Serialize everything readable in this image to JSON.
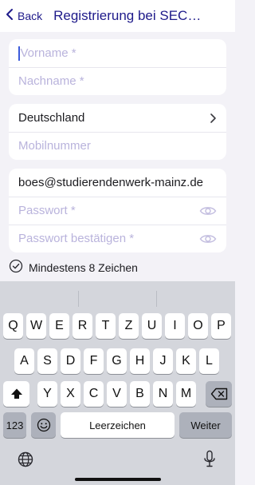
{
  "header": {
    "back_label": "Back",
    "title": "Registrierung bei SEC…"
  },
  "form": {
    "vorname_placeholder": "Vorname *",
    "nachname_placeholder": "Nachname *",
    "country_value": "Deutschland",
    "mobile_placeholder": "Mobilnummer",
    "email_value": "boes@studierendenwerk-mainz.de",
    "password_placeholder": "Passwort *",
    "password_confirm_placeholder": "Passwort bestätigen *"
  },
  "hint": {
    "text": "Mindestens 8 Zeichen"
  },
  "keyboard": {
    "row1": [
      "Q",
      "W",
      "E",
      "R",
      "T",
      "Z",
      "U",
      "I",
      "O",
      "P"
    ],
    "row2": [
      "A",
      "S",
      "D",
      "F",
      "G",
      "H",
      "J",
      "K",
      "L"
    ],
    "row3": [
      "Y",
      "X",
      "C",
      "V",
      "B",
      "N",
      "M"
    ],
    "numbers_label": "123",
    "space_label": "Leerzeichen",
    "return_label": "Weiter"
  },
  "icons": {
    "back": "chevron-left-icon",
    "chevron": "chevron-right-icon",
    "eye": "eye-icon",
    "check": "check-circle-icon",
    "shift": "shift-icon",
    "delete": "backspace-icon",
    "emoji": "emoji-icon",
    "globe": "globe-icon",
    "mic": "microphone-icon"
  },
  "colors": {
    "accent": "#1e1a8a",
    "placeholder": "#b9b3dc"
  }
}
